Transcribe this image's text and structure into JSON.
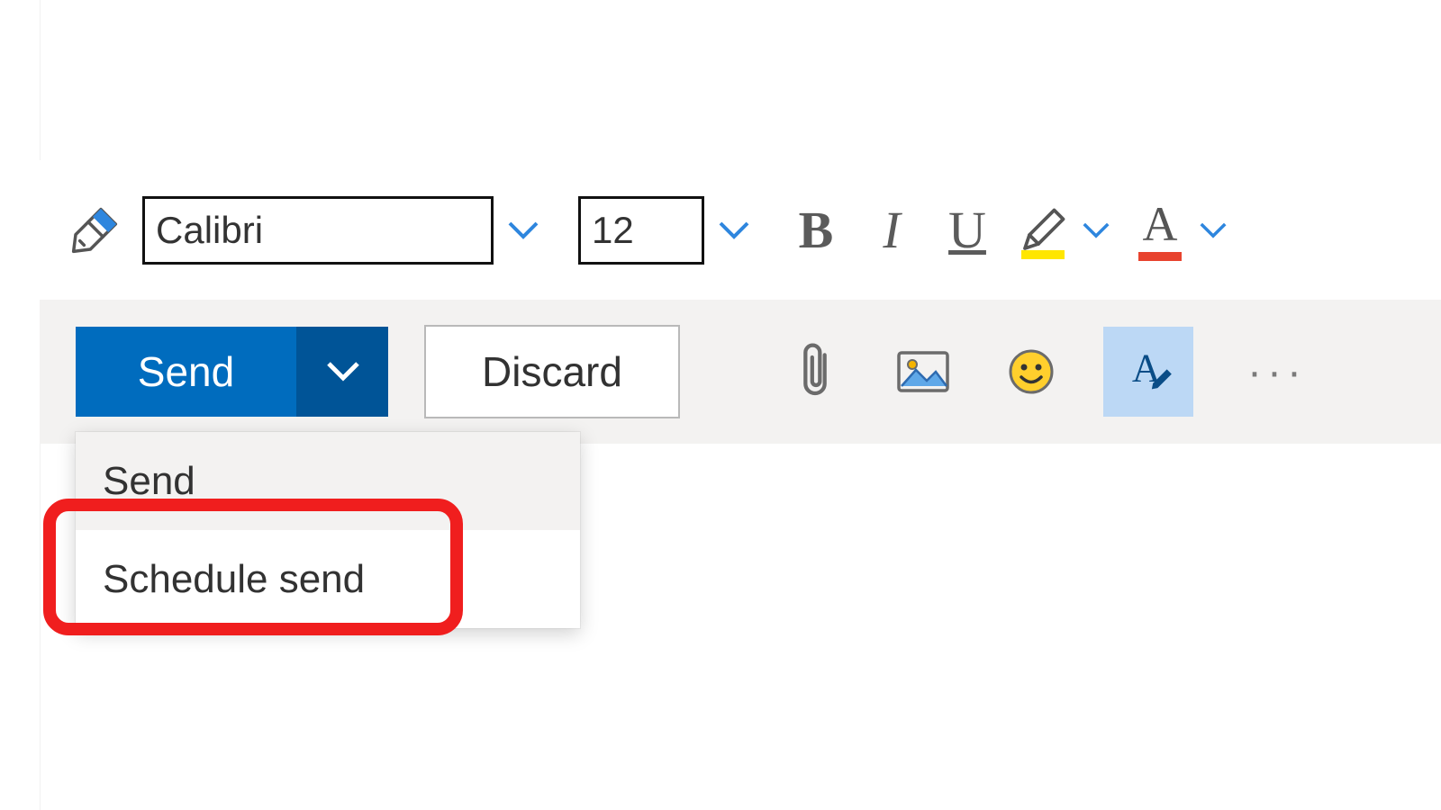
{
  "formatting": {
    "font_family_value": "Calibri",
    "font_size_value": "12",
    "bold_label": "B",
    "italic_label": "I",
    "underline_label": "U",
    "font_color_glyph": "A"
  },
  "actions": {
    "send_label": "Send",
    "discard_label": "Discard",
    "more_label": "···"
  },
  "send_menu": {
    "items": [
      {
        "label": "Send"
      },
      {
        "label": "Schedule send"
      }
    ]
  },
  "colors": {
    "primary": "#006cbe",
    "primary_dark": "#005497",
    "highlight_swatch": "#ffe600",
    "fontcolor_swatch": "#e8432e",
    "editor_toggle_bg": "#bcd8f5",
    "marker": "#f01e1e"
  }
}
